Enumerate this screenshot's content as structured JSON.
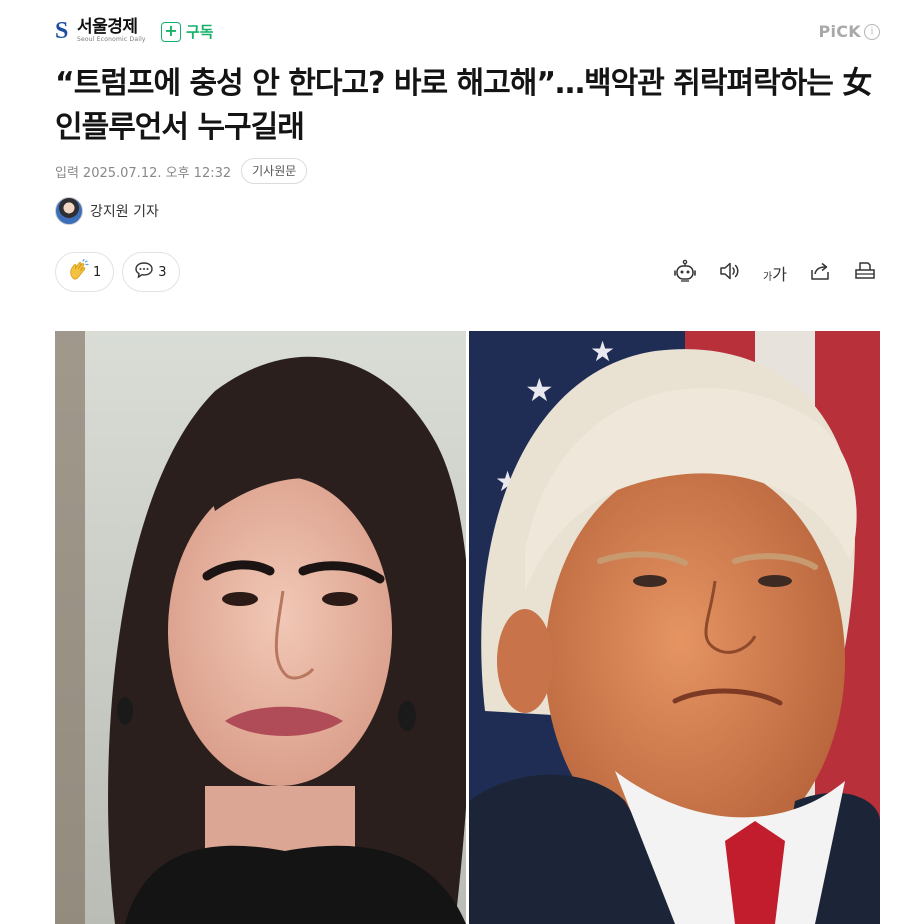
{
  "publisher": {
    "name": "서울경제",
    "tagline": "Seoul Economic Daily",
    "subscribe_label": "구독",
    "pick_label": "PiCK",
    "info_glyph": "i",
    "brand_color": "#1d4fa0",
    "subscribe_color": "#17b26a"
  },
  "article": {
    "headline": "“트럼프에 충성 안 한다고? 바로 해고해”…백악관 쥐락펴락하는 女 인플루언서 누구길래",
    "date_label": "입력",
    "date": "2025.07.12. 오후 12:32",
    "original_button": "기사원문",
    "author": "강지원 기자"
  },
  "reactions": {
    "like_count": "1",
    "comment_count": "3"
  },
  "icons": [
    "clap-icon",
    "comment-icon",
    "robot-summary-icon",
    "speaker-icon",
    "font-size-icon",
    "share-icon",
    "print-icon"
  ],
  "toolbar": {
    "font_small": "가",
    "font_large": "가"
  }
}
